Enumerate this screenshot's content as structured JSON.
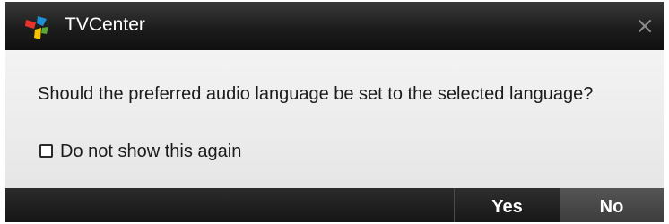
{
  "window": {
    "title": "TVCenter",
    "app_icon": "tvcenter-logo-icon",
    "close_icon": "close-icon"
  },
  "message": "Should the preferred audio language be set to the selected language?",
  "checkbox": {
    "label": "Do not show this again",
    "checked": false
  },
  "buttons": {
    "yes_label": "Yes",
    "no_label": "No"
  },
  "colors": {
    "titlebar": "#1c1c1c",
    "content_background": "#ebebeb",
    "footer": "#141414",
    "no_button": "#4a4a4a",
    "logo_red": "#e8322c",
    "logo_blue": "#1e90d6",
    "logo_yellow": "#f5c400",
    "logo_green": "#5aa832"
  }
}
